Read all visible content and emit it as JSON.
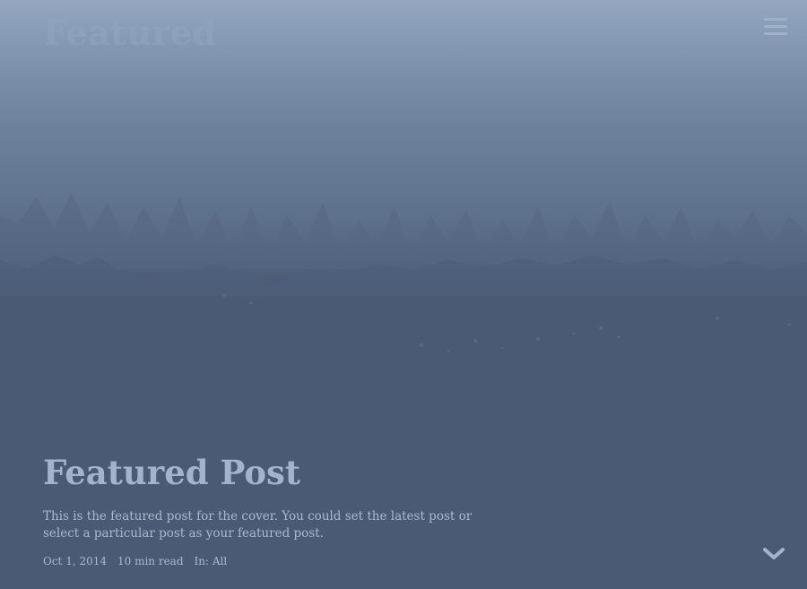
{
  "site": {
    "title": "Featured"
  },
  "header": {
    "menu_icon": "hamburger-menu-icon"
  },
  "featured_post": {
    "title": "Featured Post",
    "excerpt": "This is the featured post for the cover. You could set the latest post or select a particular post as your featured post.",
    "date": "Oct 1, 2014",
    "read_time": "10 min read",
    "category_prefix": "In:",
    "category": "All"
  },
  "scroll_indicator": {
    "icon": "chevron-down-icon"
  },
  "colors": {
    "background": "#4a5a74",
    "top_sky": "#8ea1bb",
    "text": "#a3b3cb"
  }
}
